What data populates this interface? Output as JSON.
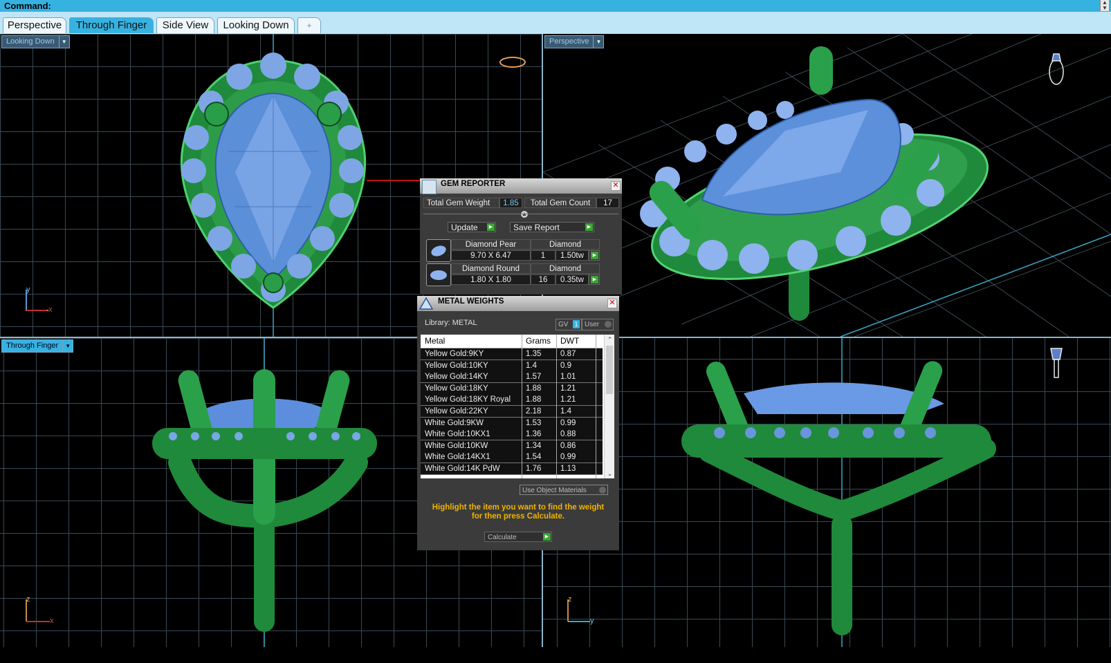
{
  "command_bar": {
    "label": "Command:"
  },
  "tabs": [
    {
      "label": "Perspective"
    },
    {
      "label": "Through Finger",
      "active": true
    },
    {
      "label": "Side View"
    },
    {
      "label": "Looking Down"
    },
    {
      "label": "+"
    }
  ],
  "viewports": {
    "top_left": {
      "label": "Looking Down",
      "axis_a": "y",
      "axis_b": "x"
    },
    "top_right": {
      "label": "Perspective"
    },
    "bottom_left": {
      "label": "Through Finger",
      "axis_a": "z",
      "axis_b": "x"
    },
    "bottom_right": {
      "label": "",
      "axis_a": "z",
      "axis_b": "y"
    }
  },
  "gem_reporter": {
    "title": "GEM REPORTER",
    "total_weight_label": "Total Gem Weight",
    "total_weight": "1.85",
    "total_count_label": "Total Gem Count",
    "total_count": "17",
    "update_label": "Update",
    "save_label": "Save Report",
    "gems": [
      {
        "shape": "Diamond Pear",
        "material": "Diamond",
        "size": "9.70 X 6.47",
        "count": "1",
        "weight": "1.50tw"
      },
      {
        "shape": "Diamond Round",
        "material": "Diamond",
        "size": "1.80 X 1.80",
        "count": "16",
        "weight": "0.35tw"
      }
    ]
  },
  "metal_weights": {
    "title": "METAL WEIGHTS",
    "library_label": "Library: METAL",
    "gv_label": "GV",
    "gv_badge": "1",
    "user_label": "User",
    "columns": [
      "Metal",
      "Grams",
      "DWT"
    ],
    "rows": [
      [
        "Yellow Gold:9KY",
        "1.35",
        "0.87"
      ],
      [
        "Yellow Gold:10KY",
        "1.4",
        "0.9"
      ],
      [
        "Yellow Gold:14KY",
        "1.57",
        "1.01"
      ],
      [
        "Yellow Gold:18KY",
        "1.88",
        "1.21"
      ],
      [
        "Yellow Gold:18KY Royal",
        "1.88",
        "1.21"
      ],
      [
        "Yellow Gold:22KY",
        "2.18",
        "1.4"
      ],
      [
        "White Gold:9KW",
        "1.53",
        "0.99"
      ],
      [
        "White Gold:10KX1",
        "1.36",
        "0.88"
      ],
      [
        "White Gold:10KW",
        "1.34",
        "0.86"
      ],
      [
        "White Gold:14KX1",
        "1.54",
        "0.99"
      ],
      [
        "White Gold:14K PdW",
        "1.76",
        "1.13"
      ]
    ],
    "use_object_materials_label": "Use Object Materials",
    "hint_text": "Highlight the item you want to find the weight for then press Calculate.",
    "calculate_label": "Calculate"
  }
}
